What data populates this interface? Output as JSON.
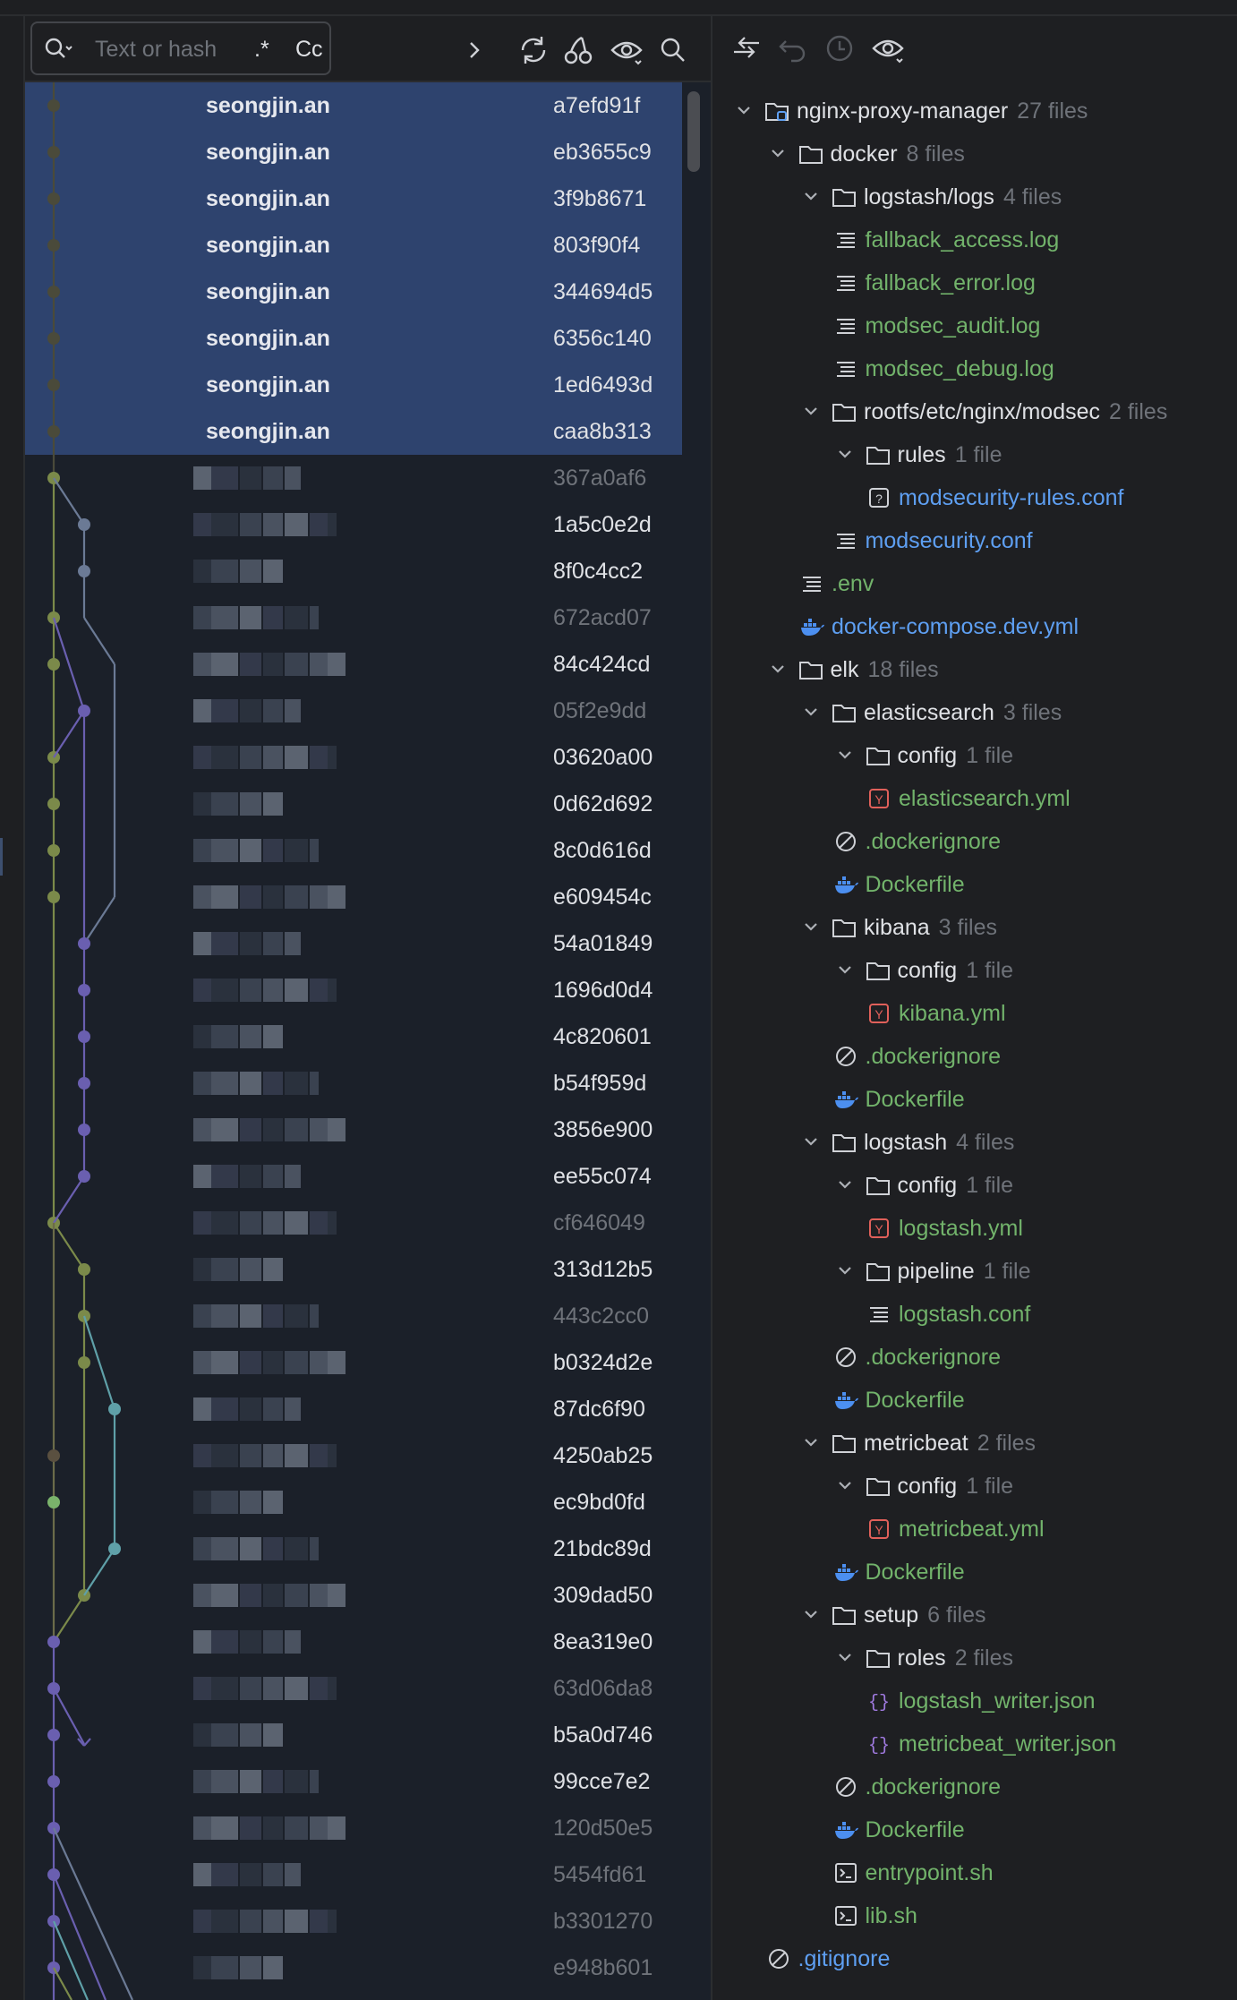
{
  "search": {
    "placeholder": "Text or hash",
    "regex_label": ".*",
    "case_label": "Cc"
  },
  "log": {
    "rows": [
      {
        "author": "seongjin.an",
        "hash": "a7efd91f",
        "selected": true
      },
      {
        "author": "seongjin.an",
        "hash": "eb3655c9",
        "selected": true
      },
      {
        "author": "seongjin.an",
        "hash": "3f9b8671",
        "selected": true
      },
      {
        "author": "seongjin.an",
        "hash": "803f90f4",
        "selected": true
      },
      {
        "author": "seongjin.an",
        "hash": "344694d5",
        "selected": true
      },
      {
        "author": "seongjin.an",
        "hash": "6356c140",
        "selected": true
      },
      {
        "author": "seongjin.an",
        "hash": "1ed6493d",
        "selected": true
      },
      {
        "author": "seongjin.an",
        "hash": "caa8b313",
        "selected": true
      },
      {
        "author": "",
        "hash": "367a0af6",
        "dim": true
      },
      {
        "author": "",
        "hash": "1a5c0e2d"
      },
      {
        "author": "",
        "hash": "8f0c4cc2"
      },
      {
        "author": "",
        "hash": "672acd07",
        "dim": true
      },
      {
        "author": "",
        "hash": "84c424cd"
      },
      {
        "author": "",
        "hash": "05f2e9dd",
        "dim": true
      },
      {
        "author": "",
        "hash": "03620a00"
      },
      {
        "author": "",
        "hash": "0d62d692"
      },
      {
        "author": "",
        "hash": "8c0d616d"
      },
      {
        "author": "",
        "hash": "e609454c"
      },
      {
        "author": "",
        "hash": "54a01849"
      },
      {
        "author": "",
        "hash": "1696d0d4"
      },
      {
        "author": "",
        "hash": "4c820601"
      },
      {
        "author": "",
        "hash": "b54f959d"
      },
      {
        "author": "",
        "hash": "3856e900"
      },
      {
        "author": "",
        "hash": "ee55c074"
      },
      {
        "author": "",
        "hash": "cf646049",
        "dim": true
      },
      {
        "author": "",
        "hash": "313d12b5"
      },
      {
        "author": "",
        "hash": "443c2cc0",
        "dim": true
      },
      {
        "author": "",
        "hash": "b0324d2e"
      },
      {
        "author": "",
        "hash": "87dc6f90"
      },
      {
        "author": "",
        "hash": "4250ab25"
      },
      {
        "author": "",
        "hash": "ec9bd0fd"
      },
      {
        "author": "",
        "hash": "21bdc89d"
      },
      {
        "author": "",
        "hash": "309dad50"
      },
      {
        "author": "",
        "hash": "8ea319e0"
      },
      {
        "author": "",
        "hash": "63d06da8",
        "dim": true
      },
      {
        "author": "",
        "hash": "b5a0d746"
      },
      {
        "author": "",
        "hash": "99cce7e2"
      },
      {
        "author": "",
        "hash": "120d50e5",
        "dim": true
      },
      {
        "author": "",
        "hash": "5454fd61",
        "dim": true
      },
      {
        "author": "",
        "hash": "b3301270",
        "dim": true
      },
      {
        "author": "",
        "hash": "e948b601",
        "dim": true
      }
    ]
  },
  "tree": [
    {
      "depth": 0,
      "type": "module",
      "name": "nginx-proxy-manager",
      "count": "27 files"
    },
    {
      "depth": 1,
      "type": "folder",
      "name": "docker",
      "count": "8 files"
    },
    {
      "depth": 2,
      "type": "folder",
      "name": "logstash/logs",
      "count": "4 files"
    },
    {
      "depth": 3,
      "type": "text",
      "name": "fallback_access.log",
      "color": "green"
    },
    {
      "depth": 3,
      "type": "text",
      "name": "fallback_error.log",
      "color": "green"
    },
    {
      "depth": 3,
      "type": "text",
      "name": "modsec_audit.log",
      "color": "green"
    },
    {
      "depth": 3,
      "type": "text",
      "name": "modsec_debug.log",
      "color": "green"
    },
    {
      "depth": 2,
      "type": "folder",
      "name": "rootfs/etc/nginx/modsec",
      "count": "2 files"
    },
    {
      "depth": 3,
      "type": "folder",
      "name": "rules",
      "count": "1 file"
    },
    {
      "depth": 4,
      "type": "unknown",
      "name": "modsecurity-rules.conf",
      "color": "blue"
    },
    {
      "depth": 3,
      "type": "text",
      "name": "modsecurity.conf",
      "color": "blue"
    },
    {
      "depth": 2,
      "type": "text",
      "name": ".env",
      "color": "green"
    },
    {
      "depth": 2,
      "type": "docker",
      "name": "docker-compose.dev.yml",
      "color": "blue"
    },
    {
      "depth": 1,
      "type": "folder",
      "name": "elk",
      "count": "18 files"
    },
    {
      "depth": 2,
      "type": "folder",
      "name": "elasticsearch",
      "count": "3 files"
    },
    {
      "depth": 3,
      "type": "folder",
      "name": "config",
      "count": "1 file"
    },
    {
      "depth": 4,
      "type": "yaml",
      "name": "elasticsearch.yml",
      "color": "green"
    },
    {
      "depth": 3,
      "type": "ignore",
      "name": ".dockerignore",
      "color": "green"
    },
    {
      "depth": 3,
      "type": "docker",
      "name": "Dockerfile",
      "color": "green"
    },
    {
      "depth": 2,
      "type": "folder",
      "name": "kibana",
      "count": "3 files"
    },
    {
      "depth": 3,
      "type": "folder",
      "name": "config",
      "count": "1 file"
    },
    {
      "depth": 4,
      "type": "yaml",
      "name": "kibana.yml",
      "color": "green"
    },
    {
      "depth": 3,
      "type": "ignore",
      "name": ".dockerignore",
      "color": "green"
    },
    {
      "depth": 3,
      "type": "docker",
      "name": "Dockerfile",
      "color": "green"
    },
    {
      "depth": 2,
      "type": "folder",
      "name": "logstash",
      "count": "4 files"
    },
    {
      "depth": 3,
      "type": "folder",
      "name": "config",
      "count": "1 file"
    },
    {
      "depth": 4,
      "type": "yaml",
      "name": "logstash.yml",
      "color": "green"
    },
    {
      "depth": 3,
      "type": "folder",
      "name": "pipeline",
      "count": "1 file"
    },
    {
      "depth": 4,
      "type": "text",
      "name": "logstash.conf",
      "color": "green"
    },
    {
      "depth": 3,
      "type": "ignore",
      "name": ".dockerignore",
      "color": "green"
    },
    {
      "depth": 3,
      "type": "docker",
      "name": "Dockerfile",
      "color": "green"
    },
    {
      "depth": 2,
      "type": "folder",
      "name": "metricbeat",
      "count": "2 files"
    },
    {
      "depth": 3,
      "type": "folder",
      "name": "config",
      "count": "1 file"
    },
    {
      "depth": 4,
      "type": "yaml",
      "name": "metricbeat.yml",
      "color": "green"
    },
    {
      "depth": 3,
      "type": "docker",
      "name": "Dockerfile",
      "color": "green"
    },
    {
      "depth": 2,
      "type": "folder",
      "name": "setup",
      "count": "6 files"
    },
    {
      "depth": 3,
      "type": "folder",
      "name": "roles",
      "count": "2 files"
    },
    {
      "depth": 4,
      "type": "json",
      "name": "logstash_writer.json",
      "color": "green"
    },
    {
      "depth": 4,
      "type": "json",
      "name": "metricbeat_writer.json",
      "color": "green"
    },
    {
      "depth": 3,
      "type": "ignore",
      "name": ".dockerignore",
      "color": "green"
    },
    {
      "depth": 3,
      "type": "docker",
      "name": "Dockerfile",
      "color": "green"
    },
    {
      "depth": 3,
      "type": "shell",
      "name": "entrypoint.sh",
      "color": "green"
    },
    {
      "depth": 3,
      "type": "shell",
      "name": "lib.sh",
      "color": "green"
    },
    {
      "depth": 1,
      "type": "ignore",
      "name": ".gitignore",
      "color": "blue"
    }
  ],
  "colors": {
    "selection": "#2e436e",
    "green": "#72b36b",
    "blue": "#5e9ff2",
    "muted": "#6f737a"
  },
  "icons": {
    "log_toolbar": [
      "search-icon",
      "chevron-right-icon",
      "refresh-icon",
      "cherry-pick-icon",
      "eye-icon",
      "magnifier-icon"
    ],
    "changes_toolbar": [
      "compare-icon",
      "undo-icon",
      "history-icon",
      "eye-icon"
    ]
  }
}
